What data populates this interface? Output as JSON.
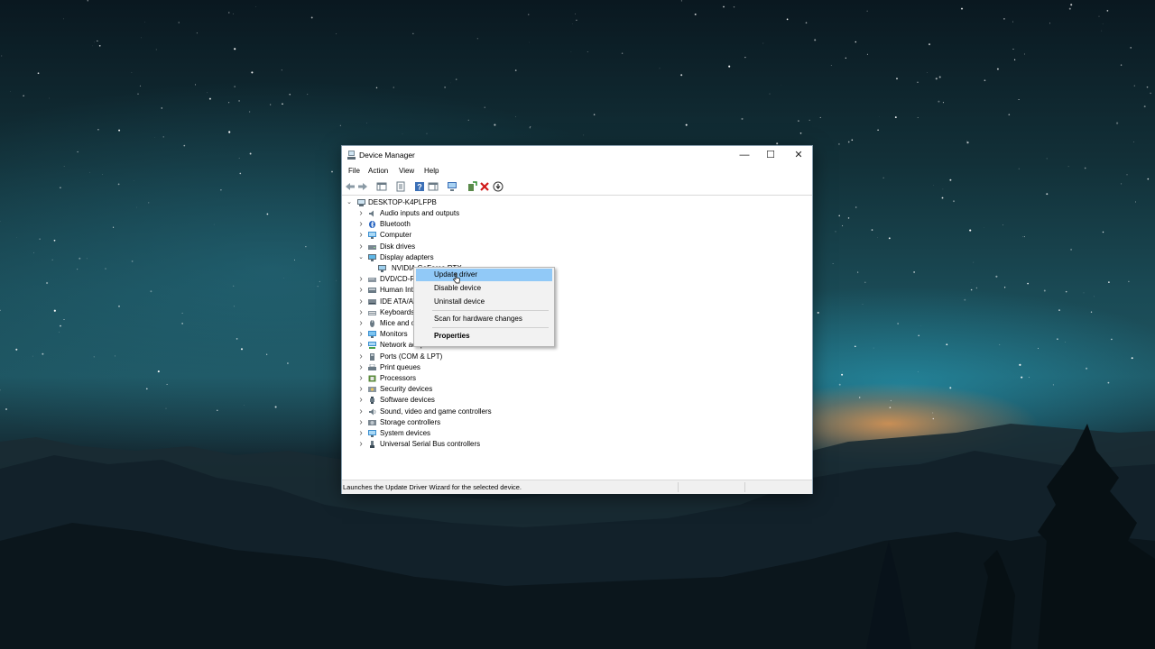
{
  "window": {
    "title": "Device Manager",
    "controls": {
      "minimize": "—",
      "maximize": "☐",
      "close": "✕"
    }
  },
  "menu": [
    "File",
    "Action",
    "View",
    "Help"
  ],
  "toolbar": {
    "icons": [
      "back-icon",
      "forward-icon",
      "show-hide-console-tree-icon",
      "properties-icon",
      "help-icon",
      "action-pane-icon",
      "update-driver-icon",
      "add-driver-icon",
      "uninstall-device-icon",
      "scan-hardware-icon"
    ]
  },
  "tree": {
    "root": "DESKTOP-K4PLFPB",
    "categories": [
      {
        "label": "Audio inputs and outputs",
        "icon": "speaker-icon"
      },
      {
        "label": "Bluetooth",
        "icon": "bluetooth-icon"
      },
      {
        "label": "Computer",
        "icon": "computer-icon"
      },
      {
        "label": "Disk drives",
        "icon": "disk-drive-icon"
      },
      {
        "label": "Display adapters",
        "icon": "display-adapter-icon",
        "expanded": true
      },
      {
        "label": "NVIDIA GeForce RTX",
        "icon": "gpu-icon",
        "child": true
      },
      {
        "label": "DVD/CD-ROM drives",
        "icon": "dvd-icon"
      },
      {
        "label": "Human Interface Devices",
        "icon": "hid-icon"
      },
      {
        "label": "IDE ATA/ATAPI controllers",
        "icon": "ide-icon"
      },
      {
        "label": "Keyboards",
        "icon": "keyboard-icon"
      },
      {
        "label": "Mice and other pointing devices",
        "icon": "mouse-icon"
      },
      {
        "label": "Monitors",
        "icon": "monitor-icon"
      },
      {
        "label": "Network adapters",
        "icon": "network-icon"
      },
      {
        "label": "Ports (COM & LPT)",
        "icon": "port-icon"
      },
      {
        "label": "Print queues",
        "icon": "printer-icon"
      },
      {
        "label": "Processors",
        "icon": "processor-icon"
      },
      {
        "label": "Security devices",
        "icon": "security-icon"
      },
      {
        "label": "Software devices",
        "icon": "software-device-icon"
      },
      {
        "label": "Sound, video and game controllers",
        "icon": "sound-icon"
      },
      {
        "label": "Storage controllers",
        "icon": "storage-icon"
      },
      {
        "label": "System devices",
        "icon": "system-devices-icon"
      },
      {
        "label": "Universal Serial Bus controllers",
        "icon": "usb-icon"
      }
    ]
  },
  "context_menu": {
    "items": [
      {
        "label": "Update driver",
        "highlighted": true
      },
      {
        "label": "Disable device"
      },
      {
        "label": "Uninstall device"
      },
      {
        "label": "Scan for hardware changes"
      },
      {
        "label": "Properties",
        "bold": true
      }
    ]
  },
  "status_bar": {
    "text": "Launches the Update Driver Wizard for the selected device."
  },
  "colors": {
    "highlight": "#91c9f7",
    "window_bg": "#ffffff",
    "menu_bg": "#f2f2f2"
  }
}
